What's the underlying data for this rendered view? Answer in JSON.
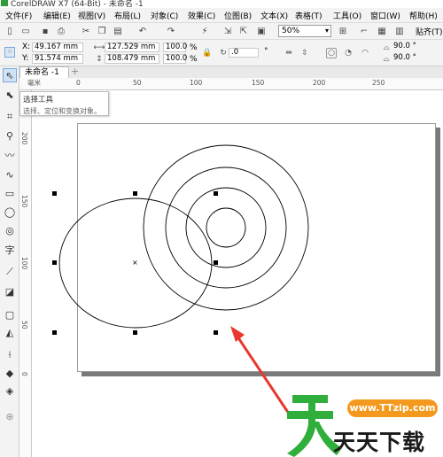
{
  "window": {
    "title": "CorelDRAW X7 (64-Bit) - 未命名 -1"
  },
  "menu": [
    {
      "label": "文件(F)"
    },
    {
      "label": "编辑(E)"
    },
    {
      "label": "视图(V)"
    },
    {
      "label": "布局(L)"
    },
    {
      "label": "对象(C)"
    },
    {
      "label": "效果(C)"
    },
    {
      "label": "位图(B)"
    },
    {
      "label": "文本(X)"
    },
    {
      "label": "表格(T)"
    },
    {
      "label": "工具(O)"
    },
    {
      "label": "窗口(W)"
    },
    {
      "label": "帮助(H)"
    }
  ],
  "toolbar": {
    "zoom_value": "50%",
    "snap_label": "贴齐(T)"
  },
  "property_bar": {
    "x_label": "X:",
    "x_value": "49.167 mm",
    "y_label": "Y:",
    "y_value": "91.574 mm",
    "width_value": "127.529 mm",
    "height_value": "108.479 mm",
    "scale_x": "100.0",
    "scale_y": "100.0",
    "percent": "%",
    "rotation": ".0",
    "degree": "°",
    "angle_start": "90.0 °",
    "angle_end": "90.0 °"
  },
  "document": {
    "tab_label": "未命名 -1",
    "add_tab_symbol": "+"
  },
  "ruler": {
    "h_ticks": [
      "0",
      "50",
      "100",
      "150",
      "200",
      "250"
    ],
    "v_ticks": [
      "200",
      "150",
      "100",
      "50",
      "0"
    ],
    "origin_label": "毫米"
  },
  "tooltip": {
    "title": "选择工具",
    "description": "选择、定位和变换对象。"
  },
  "watermark": {
    "url": "www.TTzip.com",
    "brand": "天天下载"
  },
  "icons": {
    "select": "arrow-pointer-icon",
    "shape": "node-edit-icon",
    "crop": "crop-icon",
    "zoom": "zoom-icon",
    "freehand": "freehand-icon",
    "artistic": "artistic-media-icon",
    "rectangle": "rectangle-icon",
    "ellipse": "ellipse-icon",
    "polygon": "polygon-icon",
    "text": "text-icon",
    "connector": "connector-icon",
    "interactive": "interactive-fill-icon",
    "dropshadow": "drop-shadow-icon",
    "transparency": "transparency-icon",
    "eyedropper": "eyedropper-icon",
    "fill": "fill-icon",
    "smart_fill": "smart-fill-icon",
    "add": "add-icon"
  },
  "colors": {
    "arrow": "#e8382e",
    "watermark_green": "#2fae3c",
    "watermark_orange": "#f39a1e"
  }
}
